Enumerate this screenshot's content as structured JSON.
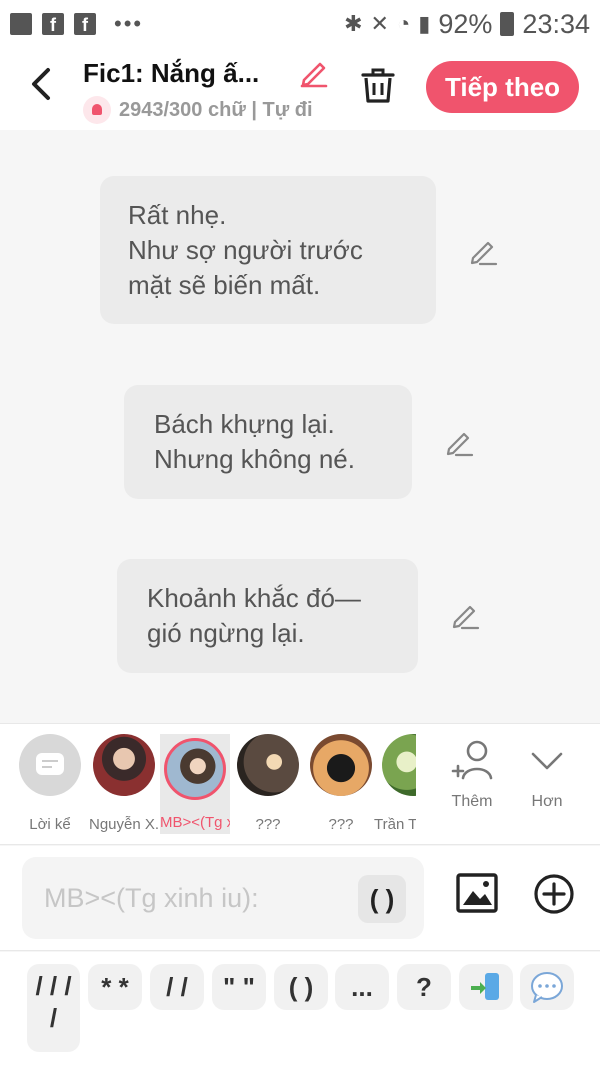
{
  "status_bar": {
    "battery": "92%",
    "time": "23:34",
    "fb_glyph": "f",
    "dots": "•••"
  },
  "header": {
    "back_glyph": "<",
    "title": "Fic1: Nắng ấ...",
    "subtitle": "2943/300 chữ | Tự đi",
    "next_label": "Tiếp theo",
    "accent_color": "#f0546d"
  },
  "messages": [
    {
      "text": "Rất nhẹ.\nNhư sợ người trước\nmặt sẽ biến mất."
    },
    {
      "text": "Bách khựng lại.\nNhưng không né."
    },
    {
      "text": "Khoảnh khắc đó—\ngió ngừng lại."
    }
  ],
  "characters": [
    {
      "label": "Lời kể",
      "avatar": "narrator-icon"
    },
    {
      "label": "Nguyễn X...",
      "avatar": "photo"
    },
    {
      "label": "MB><(Tg x...",
      "avatar": "photo",
      "selected": true
    },
    {
      "label": "???",
      "avatar": "silhouette"
    },
    {
      "label": "???",
      "avatar": "silhouette"
    },
    {
      "label": "Trần T...",
      "avatar": "photo"
    }
  ],
  "actions": {
    "add_label": "Thêm",
    "more_label": "Hơn"
  },
  "composer": {
    "placeholder": "MB><(Tg xinh iu):",
    "paren_label": "( )"
  },
  "shortcuts": [
    {
      "label": "/ / /\n/"
    },
    {
      "label": "* *"
    },
    {
      "label": "/ /"
    },
    {
      "label": "\" \""
    },
    {
      "label": "( )"
    },
    {
      "label": "..."
    },
    {
      "label": "?"
    },
    {
      "label": "",
      "icon": "phone-swap-icon"
    },
    {
      "label": "",
      "icon": "speech-bubble-icon"
    }
  ]
}
